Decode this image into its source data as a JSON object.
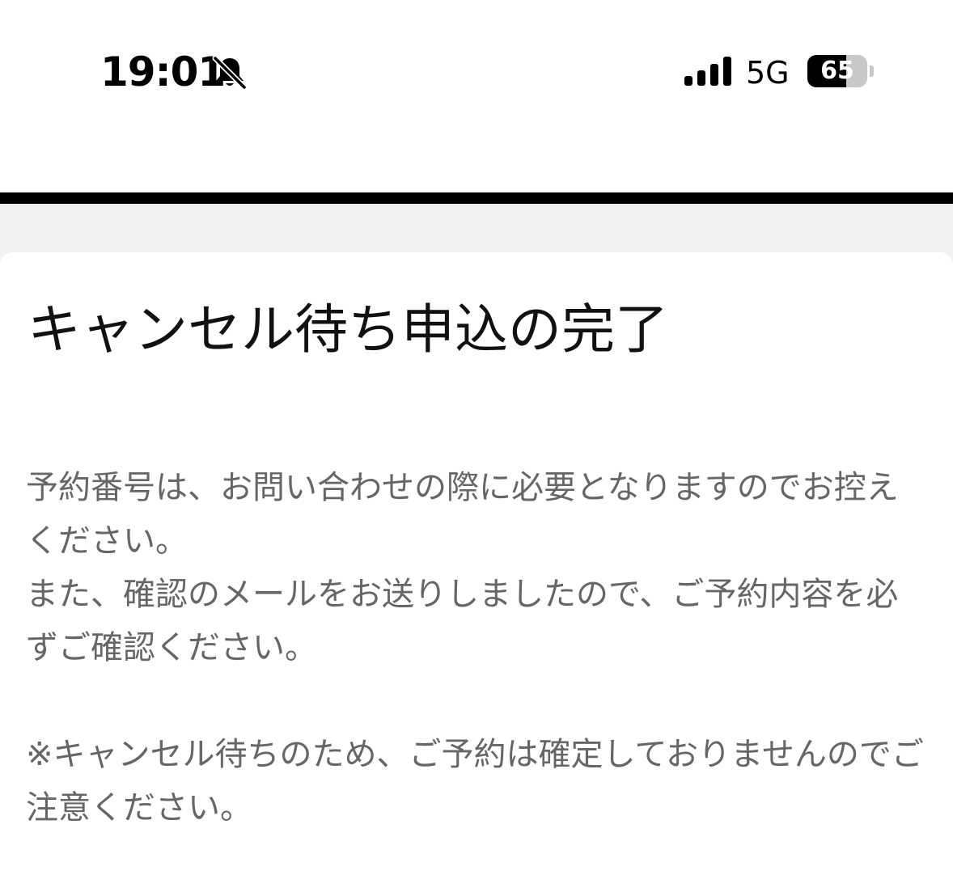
{
  "status_bar": {
    "time": "19:01",
    "silent_icon": "bell-slash-icon",
    "signal_icon": "cellular-signal-icon",
    "network": "5G",
    "battery_percent": "65",
    "battery_level": 0.65
  },
  "card": {
    "title": "キャンセル待ち申込の完了",
    "paragraphs": [
      "予約番号は、お問い合わせの際に必要となりますのでお控えください。",
      "また、確認のメールをお送りしましたので、ご予約内容を必ずご確認ください。",
      "※キャンセル待ちのため、ご予約は確定しておりませんのでご注意ください。"
    ]
  },
  "colors": {
    "header_rule": "#000000",
    "background": "#f2f2f2",
    "card": "#ffffff",
    "body_text": "#666666"
  }
}
